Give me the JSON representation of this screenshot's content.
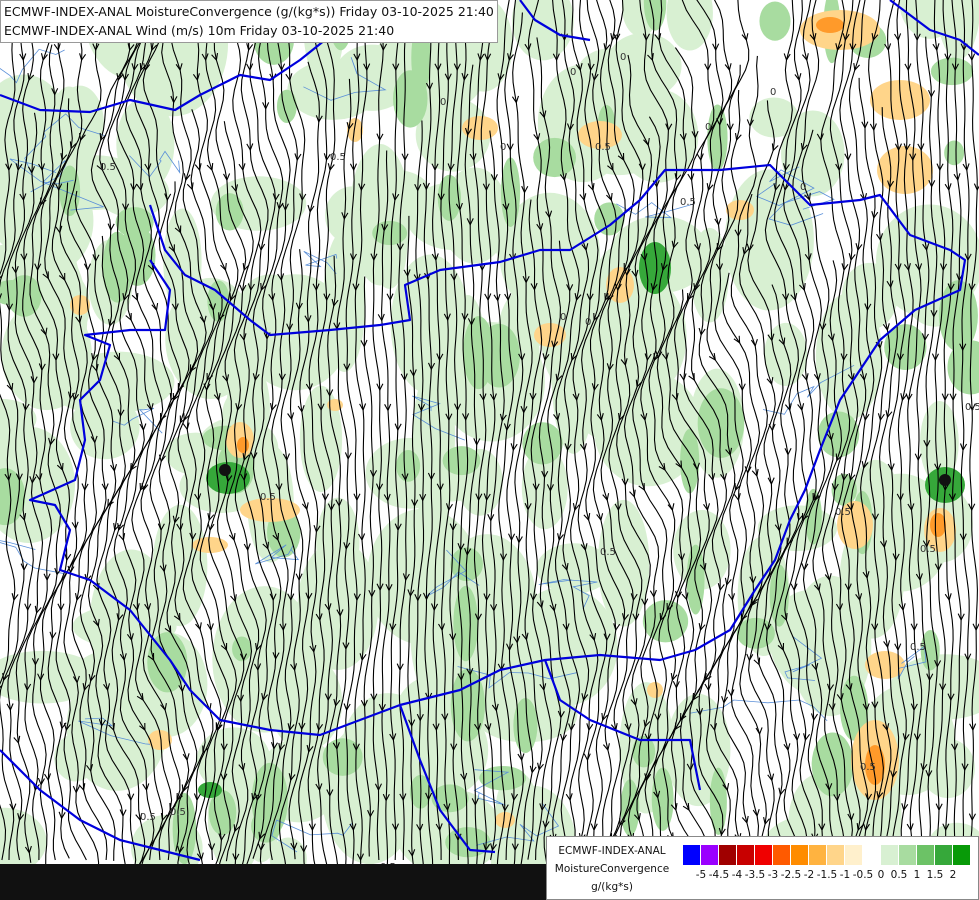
{
  "title": {
    "line1": "ECMWF-INDEX-ANAL MoistureConvergence (g/(kg*s)) Friday 03-10-2025 21:40",
    "line2": "ECMWF-INDEX-ANAL Wind (m/s) 10m Friday 03-10-2025 21:40"
  },
  "legend": {
    "line1": "ECMWF-INDEX-ANAL",
    "line2": "MoistureConvergence",
    "line3": "g/(kg*s)",
    "colors": [
      "#0000ff",
      "#9a00ff",
      "#a00000",
      "#c80000",
      "#f00000",
      "#ff5a00",
      "#ff8c00",
      "#ffb340",
      "#ffd58a",
      "#fff0cc",
      "#ffffff",
      "#d8f0d2",
      "#a8dca0",
      "#6cc266",
      "#36a83a",
      "#089a08"
    ],
    "ticks": [
      "-5",
      "-4.5",
      "-4",
      "-3.5",
      "-3",
      "-2.5",
      "-2",
      "-1.5",
      "-1",
      "-0.5",
      "0",
      "0.5",
      "1",
      "1.5",
      "2"
    ]
  },
  "contour_labels": [
    "0",
    "0",
    "0",
    "0",
    "0",
    "0",
    "0",
    "0",
    "0",
    "0.5",
    "0.5",
    "0.5",
    "0.5",
    "0.5",
    "0.5",
    "0.5",
    "0.5",
    "0.5",
    "0.5",
    "0.5",
    "0.5",
    "0.5",
    "0.5",
    "0.5"
  ],
  "theme": {
    "border": "#0000dd",
    "river": "#5a8fd8",
    "streamline": "#000000",
    "green_light": "#d8f0d2",
    "green_mid": "#a8dca0",
    "green_dark": "#36a83a",
    "orange_light": "#ffd58a",
    "orange_mid": "#ff9a2a"
  }
}
